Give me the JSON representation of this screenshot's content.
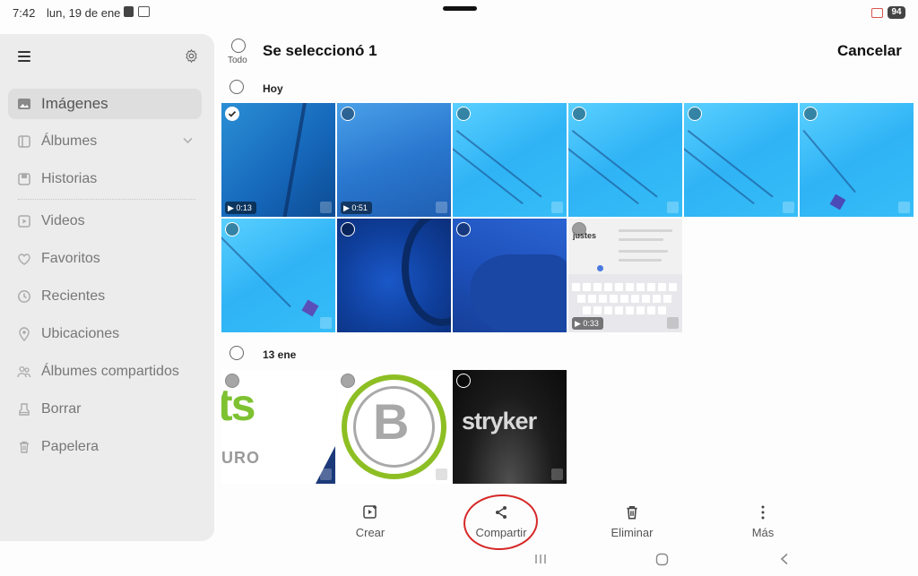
{
  "status_bar": {
    "time": "7:42",
    "date": "lun, 19 de ene",
    "battery": "94"
  },
  "sidebar": {
    "items": [
      {
        "label": "Imágenes",
        "icon": "image-icon",
        "active": true
      },
      {
        "label": "Álbumes",
        "icon": "album-icon",
        "expandable": true
      },
      {
        "label": "Historias",
        "icon": "story-icon"
      },
      {
        "label": "Videos",
        "icon": "video-icon"
      },
      {
        "label": "Favoritos",
        "icon": "heart-icon"
      },
      {
        "label": "Recientes",
        "icon": "clock-icon"
      },
      {
        "label": "Ubicaciones",
        "icon": "location-pin-icon"
      },
      {
        "label": "Álbumes compartidos",
        "icon": "shared-people-icon"
      },
      {
        "label": "Borrar",
        "icon": "eraser-icon"
      },
      {
        "label": "Papelera",
        "icon": "trash-icon"
      }
    ]
  },
  "header": {
    "select_all_label": "Todo",
    "title": "Se seleccionó 1",
    "cancel_label": "Cancelar"
  },
  "sections": [
    {
      "label": "Hoy",
      "items": [
        {
          "selected": true,
          "duration": "0:13"
        },
        {
          "selected": false,
          "duration": "0:51"
        },
        {
          "selected": false
        },
        {
          "selected": false
        },
        {
          "selected": false
        },
        {
          "selected": false
        },
        {
          "selected": false
        },
        {
          "selected": false
        },
        {
          "selected": false
        },
        {
          "selected": false,
          "duration": "0:33",
          "screenshot_title": "justes"
        }
      ]
    },
    {
      "label": "13 ene",
      "items": [
        {
          "selected": false,
          "logo_text": "ts",
          "logo_sub": "URO"
        },
        {
          "selected": false,
          "logo_text": "B"
        },
        {
          "selected": false,
          "logo_text": "stryker"
        }
      ]
    }
  ],
  "actions": {
    "create": "Crear",
    "share": "Compartir",
    "delete": "Eliminar",
    "more": "Más"
  },
  "colors": {
    "annotation_circle": "#d62828",
    "sidebar_bg": "#ececec",
    "ts_green": "#7ec232",
    "b_ring_green": "#8dbf24"
  }
}
